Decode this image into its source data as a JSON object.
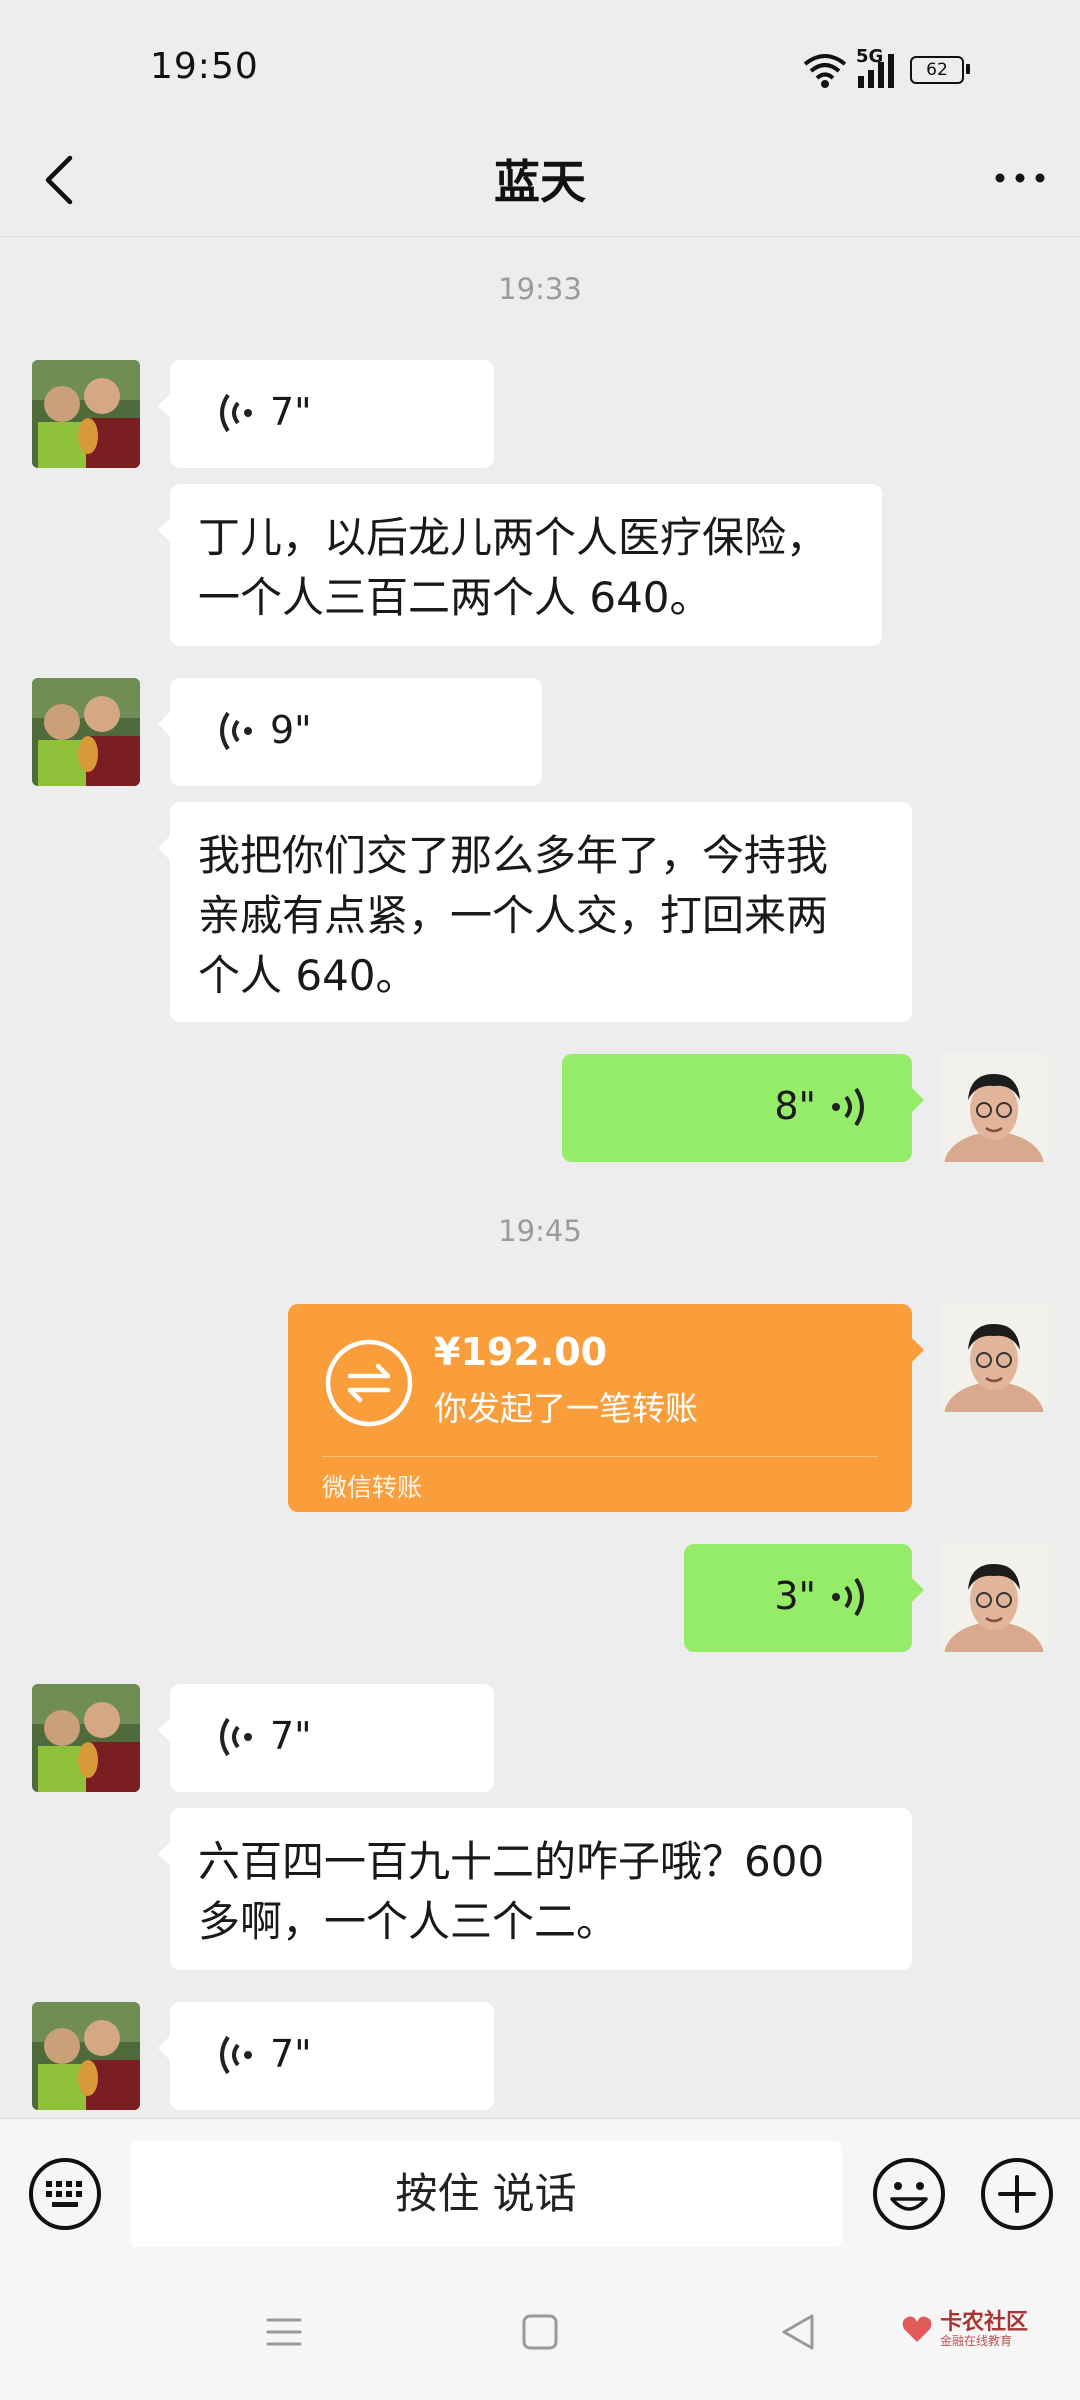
{
  "status_bar": {
    "time": "19:50",
    "network": "5G",
    "battery": "62"
  },
  "header": {
    "title": "蓝天"
  },
  "messages": {
    "ts1": "19:33",
    "m1": {
      "duration": "7\""
    },
    "m2": {
      "line1": "丁儿，以后龙儿两个人医疗保险，",
      "line2": "一个人三百二两个人 640。"
    },
    "m3": {
      "duration": "9\""
    },
    "m4": {
      "line1": "我把你们交了那么多年了，今持我",
      "line2": "亲戚有点紧，一个人交，打回来两",
      "line3": "个人 640。"
    },
    "m5": {
      "duration": "8\""
    },
    "ts2": "19:45",
    "transfer": {
      "amount": "¥192.00",
      "description": "你发起了一笔转账",
      "source": "微信转账"
    },
    "m7": {
      "duration": "3\""
    },
    "m8": {
      "duration": "7\""
    },
    "m9": {
      "line1": "六百四一百九十二的咋子哦？600",
      "line2": "多啊，一个人三个二。"
    },
    "m10": {
      "duration": "7\""
    }
  },
  "input_bar": {
    "hold_to_talk": "按住 说话"
  },
  "watermark": {
    "main": "卡农社区",
    "sub": "金融在线教育"
  },
  "colors": {
    "background": "#ededed",
    "sent_bubble": "#95ec69",
    "received_bubble": "#ffffff",
    "transfer_card": "#fa9d3b"
  },
  "icons": [
    "back-arrow-icon",
    "more-icon",
    "wifi-icon",
    "signal-icon",
    "battery-icon",
    "voice-wave-icon",
    "transfer-arrows-icon",
    "keyboard-icon",
    "emoji-icon",
    "plus-icon",
    "nav-menu-icon",
    "nav-home-icon",
    "nav-back-icon"
  ]
}
